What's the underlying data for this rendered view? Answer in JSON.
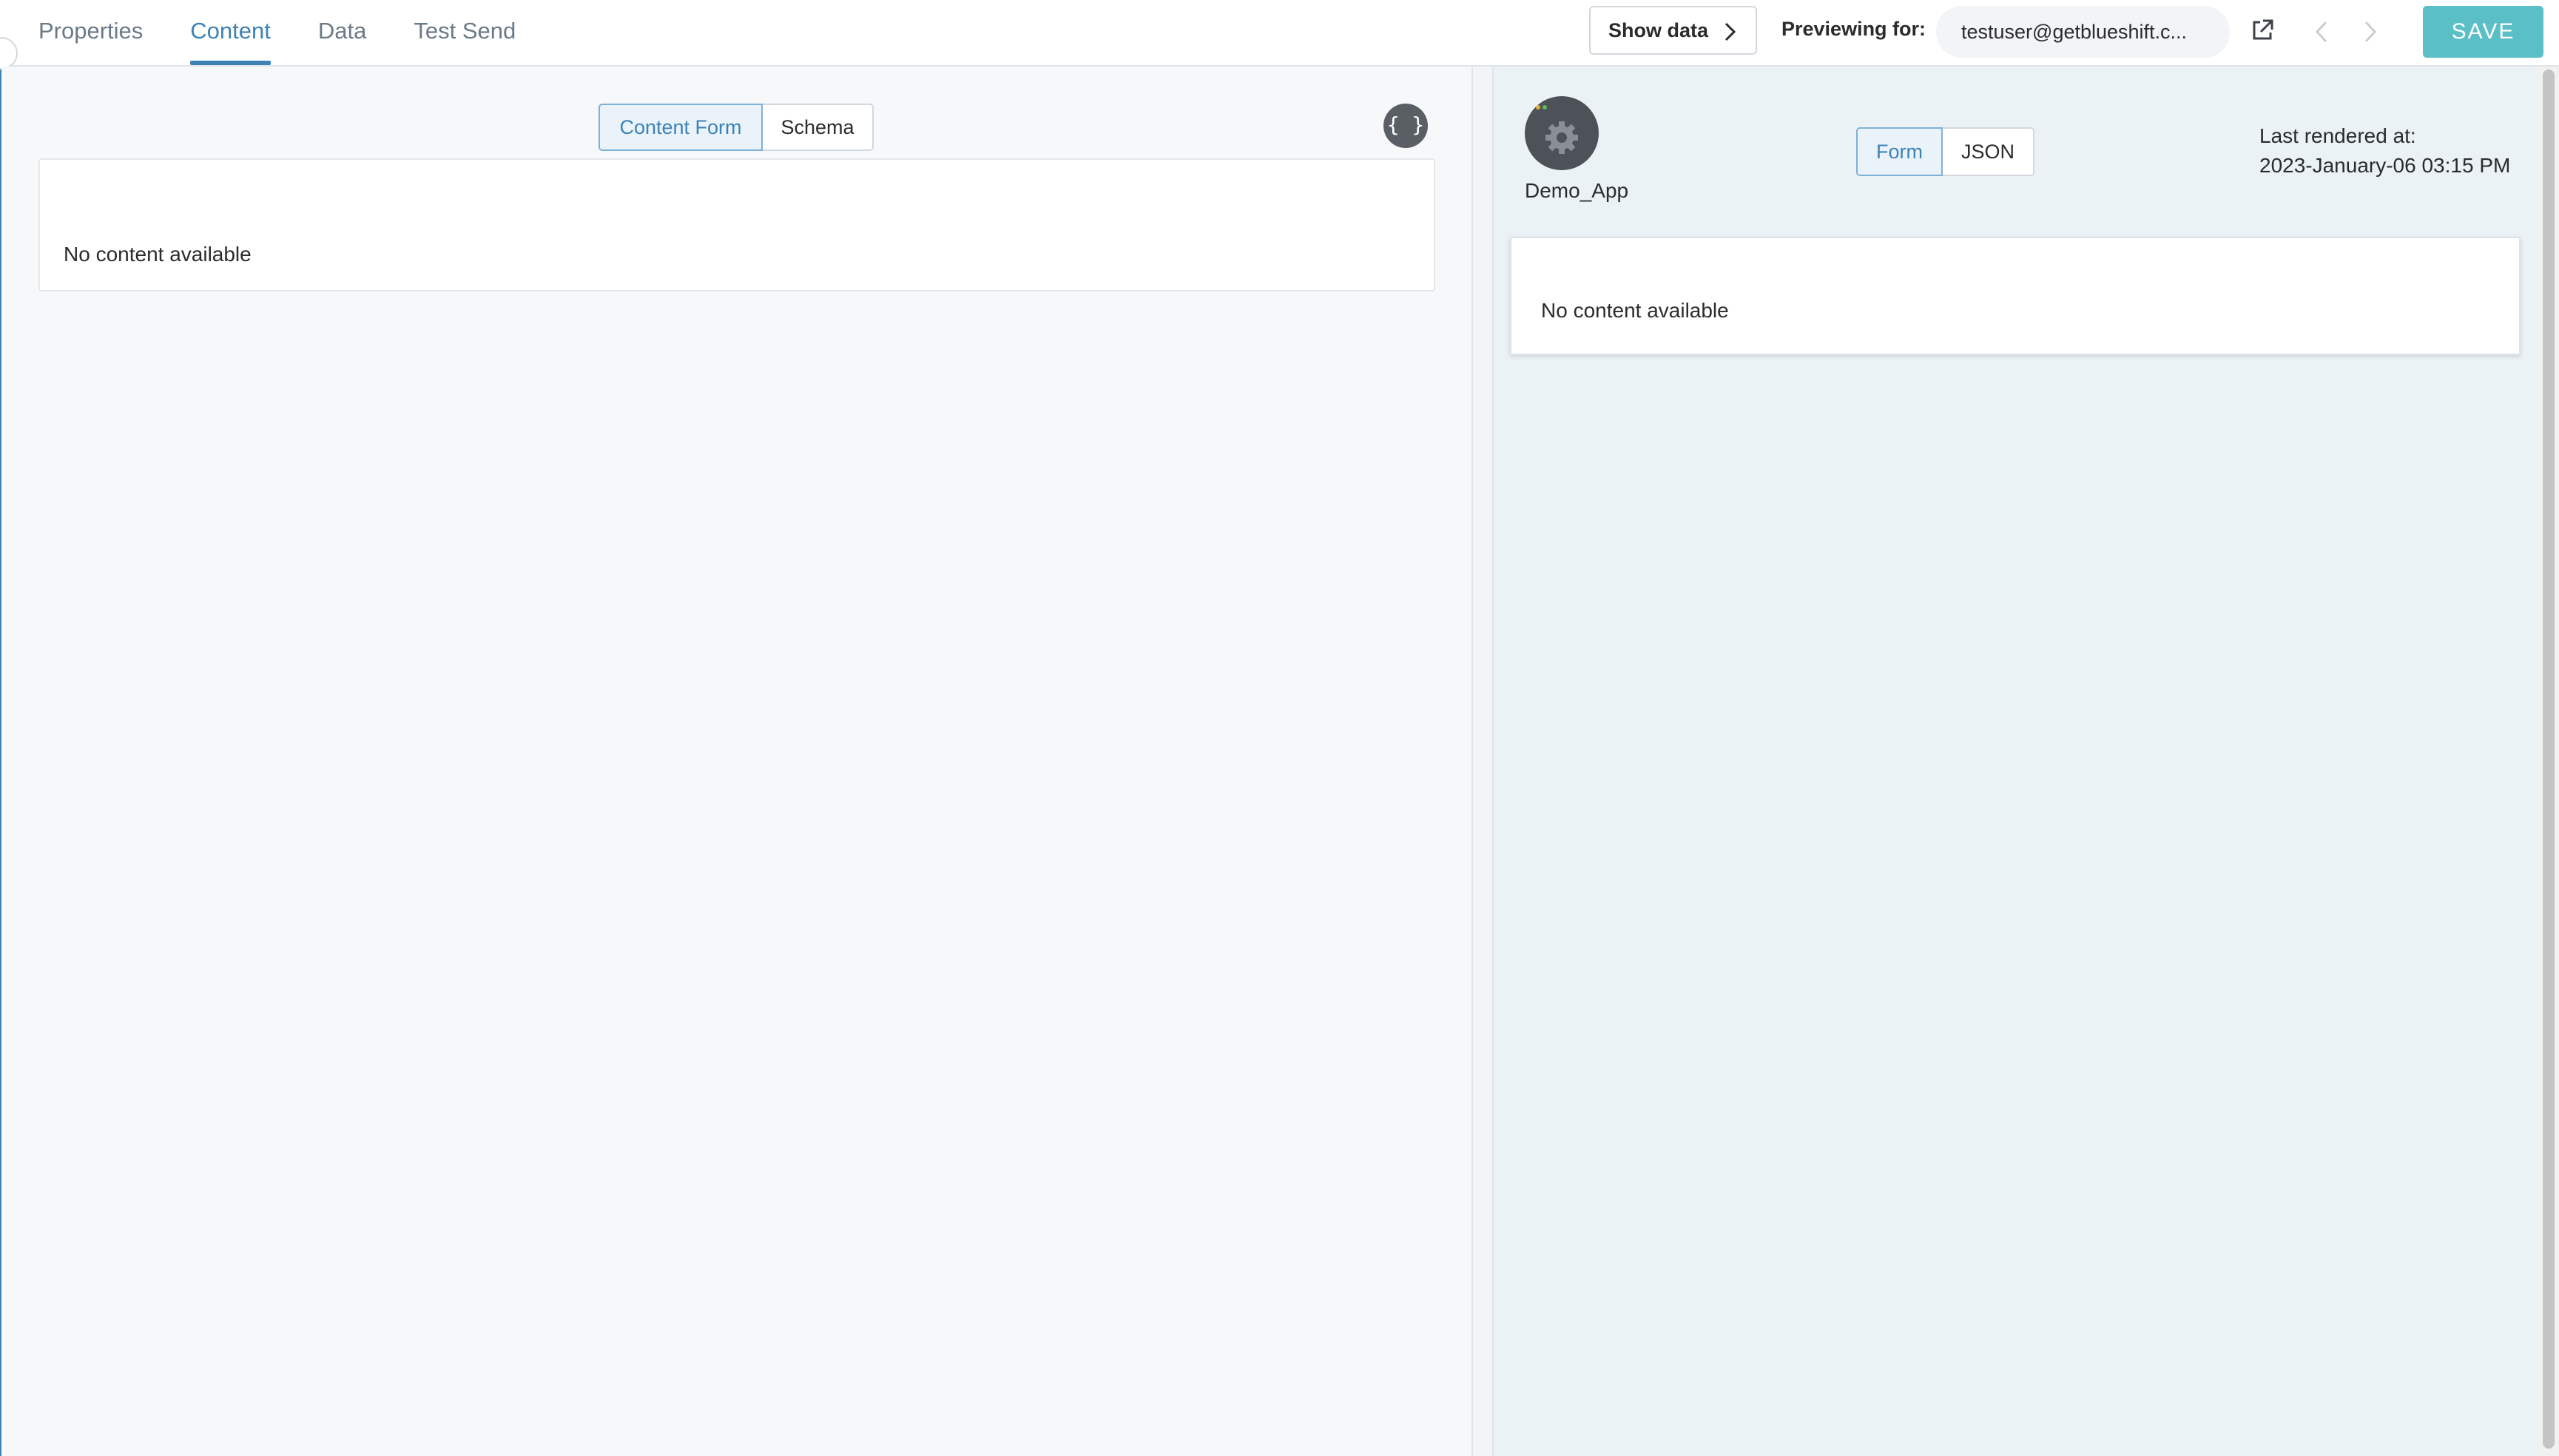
{
  "tabs": [
    {
      "label": "Properties",
      "active": false
    },
    {
      "label": "Content",
      "active": true
    },
    {
      "label": "Data",
      "active": false
    },
    {
      "label": "Test Send",
      "active": false
    }
  ],
  "toolbar": {
    "show_data_label": "Show data",
    "previewing_label": "Previewing for:",
    "preview_user": "testuser@getblueshift.c...",
    "save_label": "SAVE",
    "icons": [
      "external-link-icon",
      "chevron-left-icon",
      "chevron-right-icon",
      "chevron-right-icon"
    ]
  },
  "left_pane": {
    "segments": [
      {
        "label": "Content Form",
        "active": true
      },
      {
        "label": "Schema",
        "active": false
      }
    ],
    "code_button_label": "{ }",
    "empty_message": "No content available"
  },
  "right_pane": {
    "app_name": "Demo_App",
    "view_segments": [
      {
        "label": "Form",
        "active": true
      },
      {
        "label": "JSON",
        "active": false
      }
    ],
    "last_rendered_label": "Last rendered at:",
    "last_rendered_time": "2023-January-06 03:15 PM",
    "empty_message": "No content available"
  },
  "colors": {
    "accent": "#3d82b5",
    "save_button": "#5bbfc7",
    "right_pane_bg": "#eaf2f6",
    "left_pane_bg": "#f7f8fa"
  }
}
